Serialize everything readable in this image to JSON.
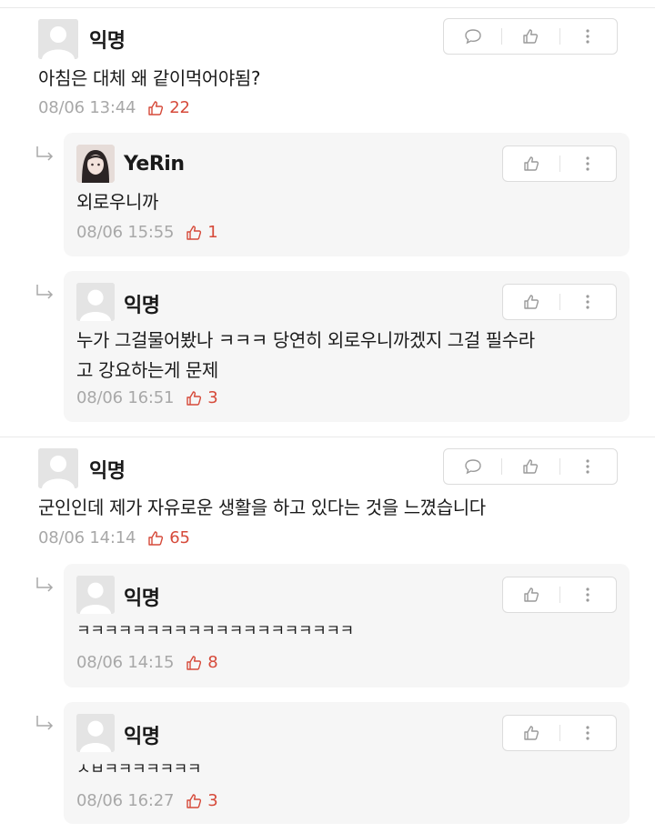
{
  "threads": [
    {
      "author": "익명",
      "body": "아침은 대체 왜 같이먹어야됨?",
      "time": "08/06 13:44",
      "likes": "22",
      "replies": [
        {
          "author": "YeRin",
          "body": "외로우니까",
          "time": "08/06 15:55",
          "likes": "1"
        },
        {
          "author": "익명",
          "body": "누가 그걸물어봤나 ㅋㅋㅋ 당연히 외로우니까겠지 그걸 필수라\n고 강요하는게 문제",
          "time": "08/06 16:51",
          "likes": "3"
        }
      ]
    },
    {
      "author": "익명",
      "body": "군인인데 제가 자유로운 생활을 하고 있다는 것을 느꼈습니다",
      "time": "08/06 14:14",
      "likes": "65",
      "replies": [
        {
          "author": "익명",
          "body": "ㅋㅋㅋㅋㅋㅋㅋㅋㅋㅋㅋㅋㅋㅋㅋㅋㅋㅋㅋㅋ",
          "time": "08/06 14:15",
          "likes": "8"
        },
        {
          "author": "익명",
          "body": "ㅅㅂㅋㅋㅋㅋㅋㅋㅋ",
          "time": "08/06 16:27",
          "likes": "3"
        }
      ]
    }
  ],
  "icons": {
    "comment": "comment-icon",
    "like": "thumbs-up-icon",
    "more": "more-vertical-icon",
    "reply_arrow": "reply-arrow-icon",
    "avatar": "default-avatar-icon"
  },
  "colors": {
    "like_count": "#d64a3a",
    "meta_text": "#a8a8a8",
    "reply_background": "#f6f6f6"
  }
}
